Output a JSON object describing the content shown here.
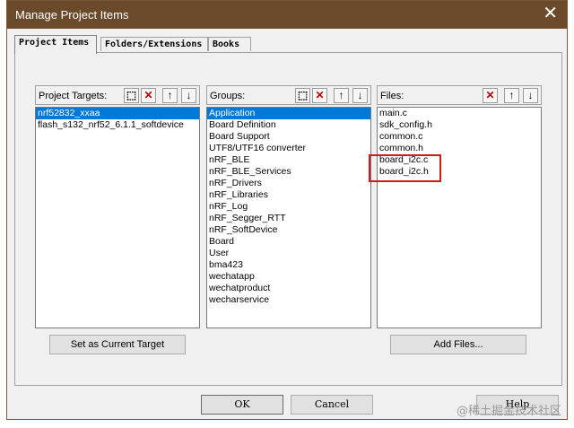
{
  "dialog": {
    "title": "Manage Project Items",
    "close_glyph": "✕"
  },
  "tabs": [
    "Project Items",
    "Folders/Extensions",
    "Books"
  ],
  "project_targets": {
    "label": "Project Targets:",
    "items": [
      "nrf52832_xxaa",
      "flash_s132_nrf52_6.1.1_softdevice"
    ],
    "selected_index": 0,
    "set_current_label": "Set as Current Target"
  },
  "groups": {
    "label": "Groups:",
    "items": [
      "Application",
      "Board Definition",
      "Board Support",
      "UTF8/UTF16 converter",
      "nRF_BLE",
      "nRF_BLE_Services",
      "nRF_Drivers",
      "nRF_Libraries",
      "nRF_Log",
      "nRF_Segger_RTT",
      "nRF_SoftDevice",
      "Board",
      "User",
      "bma423",
      "wechatapp",
      "wechatproduct",
      "wecharservice"
    ],
    "selected_index": 0
  },
  "files": {
    "label": "Files:",
    "items": [
      "main.c",
      "sdk_config.h",
      "common.c",
      "common.h",
      "board_i2c.c",
      "board_i2c.h"
    ],
    "add_label": "Add Files..."
  },
  "toolbar_icons": {
    "new": "new-icon",
    "delete": "delete-icon",
    "up": "move-up-icon",
    "down": "move-down-icon"
  },
  "footer": {
    "ok": "OK",
    "cancel": "Cancel",
    "help": "Help"
  },
  "watermark": "@稀土掘金技术社区",
  "colors": {
    "titlebar": "#6b4a2b",
    "selection": "#0078d7",
    "highlight": "#d11a1a"
  }
}
